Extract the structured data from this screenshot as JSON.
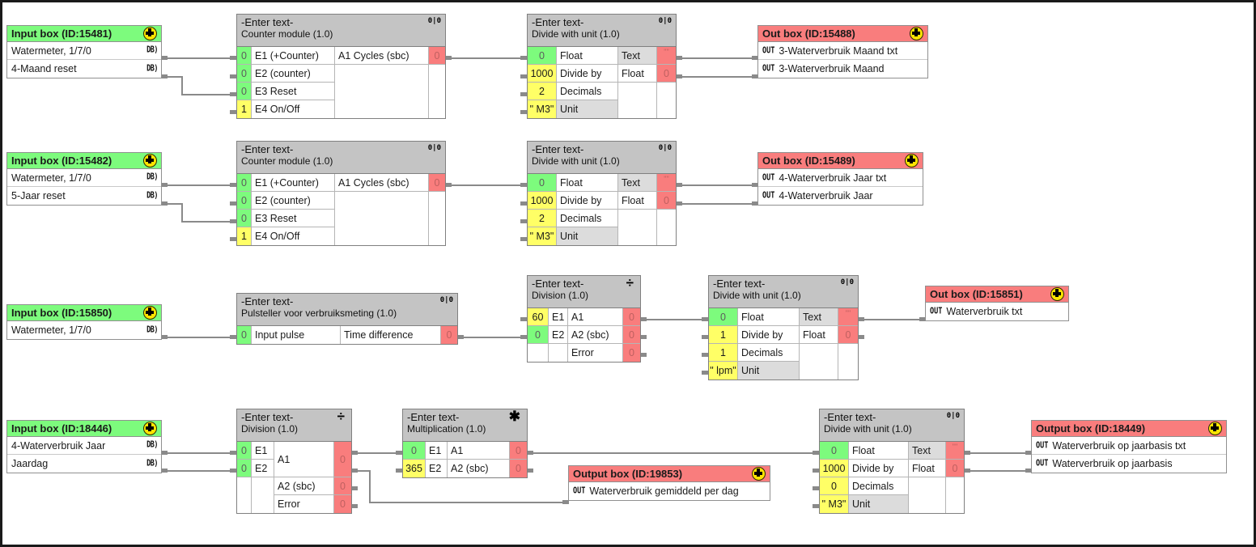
{
  "app": {
    "title": "Function block programming canvas",
    "icons": {
      "node": "node-cross-icon",
      "db_pin": "db-pin-icon",
      "out_pin": "out-pin-icon",
      "digital_badge": "0|0",
      "divide_badge": "÷",
      "multiply_badge": "✱"
    }
  },
  "blocks": [
    {
      "id": "input-15481",
      "kind": "input-box",
      "title": "Input box (ID:15481)",
      "rows": [
        {
          "label": "Watermeter, 1/7/0",
          "pin": "DB)"
        },
        {
          "label": "4-Maand reset",
          "pin": "DB)"
        }
      ]
    },
    {
      "id": "counter-1",
      "kind": "function-block",
      "title": "-Enter text-",
      "subtitle": "Counter module (1.0)",
      "badge": "0|0",
      "inputs": [
        {
          "value": "0",
          "tone": "green",
          "label": "E1 (+Counter)"
        },
        {
          "value": "0",
          "tone": "green",
          "label": "E2 (counter)"
        },
        {
          "value": "0",
          "tone": "green",
          "label": "E3 Reset"
        },
        {
          "value": "1",
          "tone": "yellow",
          "label": "E4 On/Off"
        }
      ],
      "outputs": [
        {
          "label": "A1 Cycles (sbc)",
          "value": "0"
        }
      ]
    },
    {
      "id": "divunit-1",
      "kind": "function-block",
      "title": "-Enter text-",
      "subtitle": "Divide with unit (1.0)",
      "badge": "0|0",
      "inputs": [
        {
          "value": "0",
          "tone": "green",
          "label": "Float"
        },
        {
          "value": "1000",
          "tone": "yellow",
          "label": "Divide by"
        },
        {
          "value": "2",
          "tone": "yellow",
          "label": "Decimals"
        },
        {
          "value": "\" M3\"",
          "tone": "yellow",
          "label": "Unit",
          "label_tone": "grey"
        }
      ],
      "outputs": [
        {
          "label": "Text",
          "value": "\"\"",
          "label_tone": "grey"
        },
        {
          "label": "Float",
          "value": "0"
        }
      ]
    },
    {
      "id": "out-15488",
      "kind": "out-box",
      "title": "Out box (ID:15488)",
      "rows": [
        {
          "pin": "OUT",
          "label": "3-Waterverbruik Maand txt"
        },
        {
          "pin": "OUT",
          "label": "3-Waterverbruik Maand"
        }
      ]
    },
    {
      "id": "input-15482",
      "kind": "input-box",
      "title": "Input box (ID:15482)",
      "rows": [
        {
          "label": "Watermeter, 1/7/0",
          "pin": "DB)"
        },
        {
          "label": "5-Jaar reset",
          "pin": "DB)"
        }
      ]
    },
    {
      "id": "counter-2",
      "kind": "function-block",
      "title": "-Enter text-",
      "subtitle": "Counter module (1.0)",
      "badge": "0|0",
      "inputs": [
        {
          "value": "0",
          "tone": "green",
          "label": "E1 (+Counter)"
        },
        {
          "value": "0",
          "tone": "green",
          "label": "E2 (counter)"
        },
        {
          "value": "0",
          "tone": "green",
          "label": "E3 Reset"
        },
        {
          "value": "1",
          "tone": "yellow",
          "label": "E4 On/Off"
        }
      ],
      "outputs": [
        {
          "label": "A1 Cycles (sbc)",
          "value": "0"
        }
      ]
    },
    {
      "id": "divunit-2",
      "kind": "function-block",
      "title": "-Enter text-",
      "subtitle": "Divide with unit (1.0)",
      "badge": "0|0",
      "inputs": [
        {
          "value": "0",
          "tone": "green",
          "label": "Float"
        },
        {
          "value": "1000",
          "tone": "yellow",
          "label": "Divide by"
        },
        {
          "value": "2",
          "tone": "yellow",
          "label": "Decimals"
        },
        {
          "value": "\" M3\"",
          "tone": "yellow",
          "label": "Unit",
          "label_tone": "grey"
        }
      ],
      "outputs": [
        {
          "label": "Text",
          "value": "\"\"",
          "label_tone": "grey"
        },
        {
          "label": "Float",
          "value": "0"
        }
      ]
    },
    {
      "id": "out-15489",
      "kind": "out-box",
      "title": "Out box (ID:15489)",
      "rows": [
        {
          "pin": "OUT",
          "label": "4-Waterverbruik Jaar txt"
        },
        {
          "pin": "OUT",
          "label": "4-Waterverbruik Jaar"
        }
      ]
    },
    {
      "id": "input-15850",
      "kind": "input-box",
      "title": "Input box (ID:15850)",
      "rows": [
        {
          "label": "Watermeter, 1/7/0",
          "pin": "DB)"
        }
      ]
    },
    {
      "id": "pulsteller",
      "kind": "function-block",
      "title": "-Enter text-",
      "subtitle": "Pulsteller voor verbruiksmeting (1.0)",
      "badge": "0|0",
      "inputs": [
        {
          "value": "0",
          "tone": "green",
          "label": "Input pulse"
        }
      ],
      "outputs": [
        {
          "label": "Time difference",
          "value": "0"
        }
      ]
    },
    {
      "id": "division-1",
      "kind": "function-block",
      "title": "-Enter text-",
      "subtitle": "Division (1.0)",
      "badge": "÷",
      "inputs": [
        {
          "value": "60",
          "tone": "yellow",
          "label": "E1"
        },
        {
          "value": "0",
          "tone": "green",
          "label": "E2"
        },
        {
          "value": "",
          "tone": "blank",
          "label": ""
        }
      ],
      "outputs": [
        {
          "label": "A1",
          "value": "0"
        },
        {
          "label": "A2 (sbc)",
          "value": "0"
        },
        {
          "label": "Error",
          "value": "0"
        }
      ]
    },
    {
      "id": "divunit-3",
      "kind": "function-block",
      "title": "-Enter text-",
      "subtitle": "Divide with unit (1.0)",
      "badge": "0|0",
      "inputs": [
        {
          "value": "0",
          "tone": "green",
          "label": "Float"
        },
        {
          "value": "1",
          "tone": "yellow",
          "label": "Divide by"
        },
        {
          "value": "1",
          "tone": "yellow",
          "label": "Decimals"
        },
        {
          "value": "\" lpm\"",
          "tone": "yellow",
          "label": "Unit",
          "label_tone": "grey"
        }
      ],
      "outputs": [
        {
          "label": "Text",
          "value": "\"\"",
          "label_tone": "grey"
        },
        {
          "label": "Float",
          "value": "0"
        }
      ]
    },
    {
      "id": "out-15851",
      "kind": "out-box",
      "title": "Out box (ID:15851)",
      "rows": [
        {
          "pin": "OUT",
          "label": "Waterverbruik txt"
        }
      ]
    },
    {
      "id": "input-18446",
      "kind": "input-box",
      "title": "Input box (ID:18446)",
      "rows": [
        {
          "label": "4-Waterverbruik Jaar",
          "pin": "DB)"
        },
        {
          "label": "Jaardag",
          "pin": "DB)"
        }
      ]
    },
    {
      "id": "division-2",
      "kind": "function-block",
      "title": "-Enter text-",
      "subtitle": "Division (1.0)",
      "badge": "÷",
      "inputs": [
        {
          "value": "0",
          "tone": "green",
          "label": "E1"
        },
        {
          "value": "0",
          "tone": "green",
          "label": "E2"
        },
        {
          "value": "",
          "tone": "blank",
          "label": ""
        }
      ],
      "outputs": [
        {
          "label": "A1",
          "value": "0",
          "span": 2
        },
        {
          "label": "A2 (sbc)",
          "value": "0"
        },
        {
          "label": "Error",
          "value": "0"
        }
      ]
    },
    {
      "id": "multiplication",
      "kind": "function-block",
      "title": "-Enter text-",
      "subtitle": "Multiplication (1.0)",
      "badge": "✱",
      "inputs": [
        {
          "value": "0",
          "tone": "green",
          "label": "E1"
        },
        {
          "value": "365",
          "tone": "yellow",
          "label": "E2"
        }
      ],
      "outputs": [
        {
          "label": "A1",
          "value": "0"
        },
        {
          "label": "A2 (sbc)",
          "value": "0"
        }
      ]
    },
    {
      "id": "out-19853",
      "kind": "out-box",
      "title": "Output box (ID:19853)",
      "rows": [
        {
          "pin": "OUT",
          "label": "Waterverbruik gemiddeld per dag"
        }
      ]
    },
    {
      "id": "divunit-4",
      "kind": "function-block",
      "title": "-Enter text-",
      "subtitle": "Divide with unit (1.0)",
      "badge": "0|0",
      "inputs": [
        {
          "value": "0",
          "tone": "green",
          "label": "Float"
        },
        {
          "value": "1000",
          "tone": "yellow",
          "label": "Divide by"
        },
        {
          "value": "0",
          "tone": "yellow",
          "label": "Decimals"
        },
        {
          "value": "\" M3\"",
          "tone": "yellow",
          "label": "Unit",
          "label_tone": "grey"
        }
      ],
      "outputs": [
        {
          "label": "Text",
          "value": "\"\"",
          "label_tone": "grey"
        },
        {
          "label": "Float",
          "value": "0"
        }
      ]
    },
    {
      "id": "out-18449",
      "kind": "out-box",
      "title": "Output box (ID:18449)",
      "rows": [
        {
          "pin": "OUT",
          "label": "Waterverbruik op jaarbasis txt"
        },
        {
          "pin": "OUT",
          "label": "Waterverbruik op jaarbasis"
        }
      ]
    }
  ],
  "colors": {
    "input_header": "#7dfb7d",
    "output_header": "#f97d7d",
    "block_header": "#c4c4c4",
    "constant": "#ffff66",
    "wire": "#8a8a8a",
    "canvas_border": "#1a1a1a"
  }
}
